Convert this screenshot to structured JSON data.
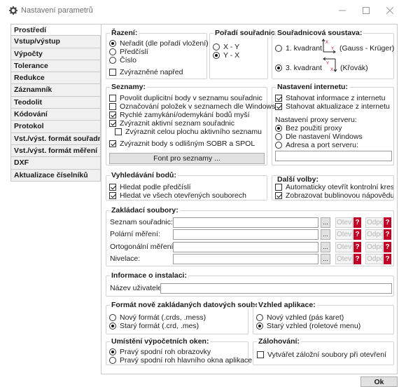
{
  "window": {
    "title": "Nastavení parametrů"
  },
  "nav": [
    "Prostředí",
    "Vstup/výstup",
    "Výpočty",
    "Tolerance",
    "Redukce",
    "Záznamník",
    "Teodolit",
    "Kódování",
    "Protokol",
    "Vst./výst. formát souřadnic",
    "Vst./výst. formát měření",
    "DXF",
    "Aktualizace číselníků"
  ],
  "razeni": {
    "title": "Řazení:",
    "opt1": "Neřadit (dle pořadí vložení)",
    "opt2": "Předčíslí",
    "opt3": "Číslo",
    "highlight": "Zvýrazněné napřed"
  },
  "poradi": {
    "title": "Pořadí souřadnic:",
    "opt1": "X - Y",
    "opt2": "Y - X"
  },
  "soustava": {
    "title": "Souřadnicová soustava:",
    "opt1": "1. kvadrant",
    "opt1_note": "(Gauss - Krüger)",
    "opt2": "3. kvadrant",
    "opt2_note": "(Křovák)",
    "axis_x": "X",
    "axis_y": "Y"
  },
  "seznamy": {
    "title": "Seznamy:",
    "c1": "Povolit duplicitní body v seznamu souřadnic",
    "c2": "Označování položek v seznamech dle Windows",
    "c3": "Rychlé zamykání/odemykání bodů myší",
    "c4": "Zvýraznit aktivní seznam souřadnic",
    "c5": "Zvýraznit celou plochu aktivního seznamu",
    "c6": "Zvýraznit body s odlišným SOBR a SPOL",
    "font_button": "Font pro seznamy ..."
  },
  "internet": {
    "title": "Nastavení internetu:",
    "c1": "Stahovat informace z internetu",
    "c2": "Stahovat aktualizace z internetu",
    "proxy_label": "Nastavení proxy serveru:",
    "r1": "Bez použití proxy",
    "r2": "Dle nastavení Windows",
    "r3": "Adresa a port serveru:"
  },
  "vyhledavani": {
    "title": "Vyhledávání bodů:",
    "c1": "Hledat podle předčíslí",
    "c2": "Hledat ve všech otevřených souborech"
  },
  "dalsi": {
    "title": "Další volby:",
    "c1": "Automaticky otevřít kontrolní kresbu",
    "c2": "Zobrazovat bublinovou nápovědu"
  },
  "zakladaci": {
    "title": "Zakládací soubory:",
    "browse": "...",
    "open": "Otevř",
    "remove": "Odpo",
    "help": "?",
    "rows": [
      "Seznam souřadnic:",
      "Polární měření:",
      "Ortogonální měření:",
      "Nivelace:"
    ]
  },
  "instalace": {
    "title": "Informace o instalaci:",
    "user_label": "Název uživatele:"
  },
  "format": {
    "title": "Formát nově zakládaných datových souborů:",
    "r1": "Nový formát (.crds, .mess)",
    "r2": "Starý formát (.crd, .mes)"
  },
  "vzhled": {
    "title": "Vzhled aplikace:",
    "r1": "Nový vzhled (pás karet)",
    "r2": "Starý vzhled (roletové menu)"
  },
  "umisteni": {
    "title": "Umístění výpočetních oken:",
    "r1": "Pravý spodní roh obrazovky",
    "r2": "Pravý spodní roh hlavního okna aplikace"
  },
  "zalohovani": {
    "title": "Zálohování:",
    "c1": "Vytvářet záložní soubory při otevření"
  },
  "ok": "Ok"
}
